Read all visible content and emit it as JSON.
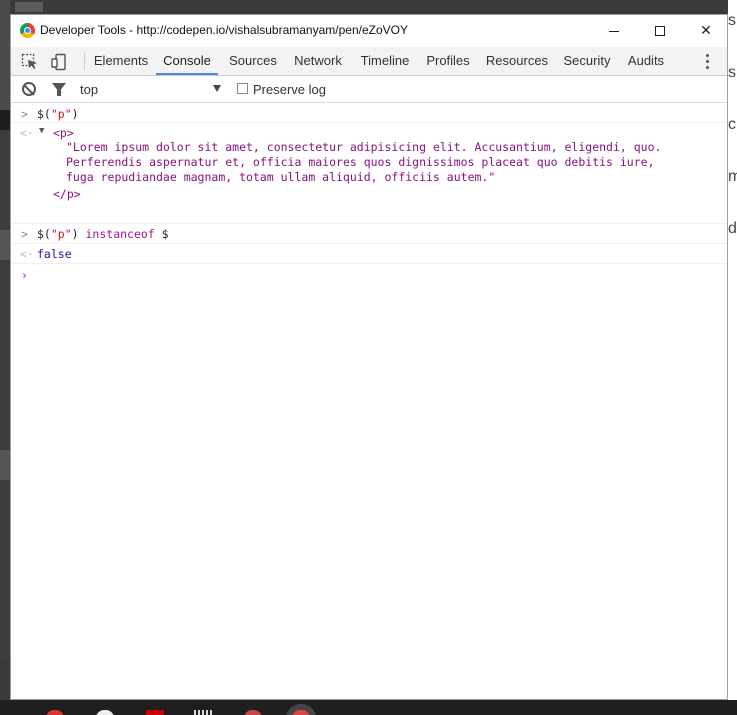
{
  "window": {
    "title": "Developer Tools - http://codepen.io/vishalsubramanyam/pen/eZoVOY",
    "controls": {
      "minimize": "minimize",
      "maximize": "maximize",
      "close": "✕"
    }
  },
  "toolbar": {
    "tabs": [
      {
        "label": "Elements",
        "active": false
      },
      {
        "label": "Console",
        "active": true
      },
      {
        "label": "Sources",
        "active": false
      },
      {
        "label": "Network",
        "active": false
      },
      {
        "label": "Timeline",
        "active": false
      },
      {
        "label": "Profiles",
        "active": false
      },
      {
        "label": "Resources",
        "active": false
      },
      {
        "label": "Security",
        "active": false
      },
      {
        "label": "Audits",
        "active": false
      }
    ]
  },
  "filter": {
    "context": "top",
    "preserve_log_label": "Preserve log",
    "preserve_log_checked": false
  },
  "console": {
    "entries": [
      {
        "type": "input",
        "parts": [
          "$(",
          "\"p\"",
          ")"
        ]
      },
      {
        "type": "output",
        "open_tag": "<p>",
        "text": "\"Lorem ipsum dolor sit amet, consectetur adipisicing elit. Accusantium, eligendi, quo.",
        "text2": "Perferendis aspernatur et, officia maiores quos dignissimos placeat quo debitis iure,",
        "text3": "fuga repudiandae magnam, totam ullam aliquid, officiis autem.\"",
        "close_tag": "</p>"
      },
      {
        "type": "input",
        "parts": [
          "$(",
          "\"p\"",
          ") ",
          "instanceof",
          " $"
        ]
      },
      {
        "type": "output",
        "value": "false"
      }
    ]
  },
  "background_right_letters": [
    "s",
    "s",
    "c",
    "m",
    "d"
  ],
  "colors": {
    "active_tab_underline": "#4c88e8",
    "string": "#c41a16",
    "tag": "#881280",
    "boolean": "#1a1aa6",
    "prompt_caret": "#367cf1"
  }
}
